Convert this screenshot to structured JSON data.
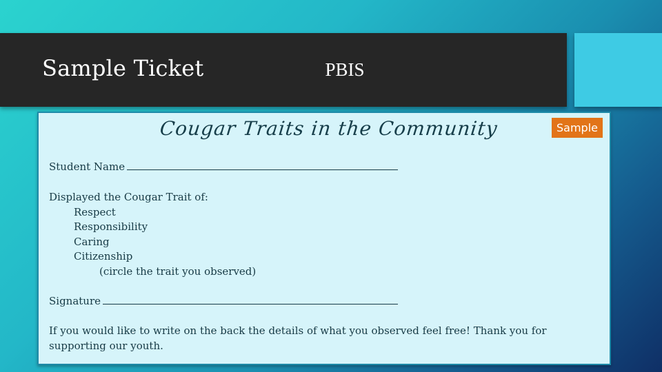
{
  "slide": {
    "title": "Sample Ticket",
    "section_label": "PBIS"
  },
  "ticket": {
    "heading": "Cougar Traits in the Community",
    "badge": "Sample",
    "student_name_label": "Student Name",
    "traits_intro": "Displayed the Cougar Trait of:",
    "traits": [
      "Respect",
      "Responsibility",
      "Caring",
      "Citizenship"
    ],
    "traits_instruction": "(circle the trait you observed)",
    "signature_label": "Signature",
    "footer": "If you would like to write on the back the details of what you observed feel free! Thank you for supporting our youth."
  },
  "colors": {
    "title_bar": "#262626",
    "pbis_box": "#3ecbe4",
    "ticket_bg": "#d6f4fa",
    "badge": "#e27418",
    "text": "#173a45"
  }
}
